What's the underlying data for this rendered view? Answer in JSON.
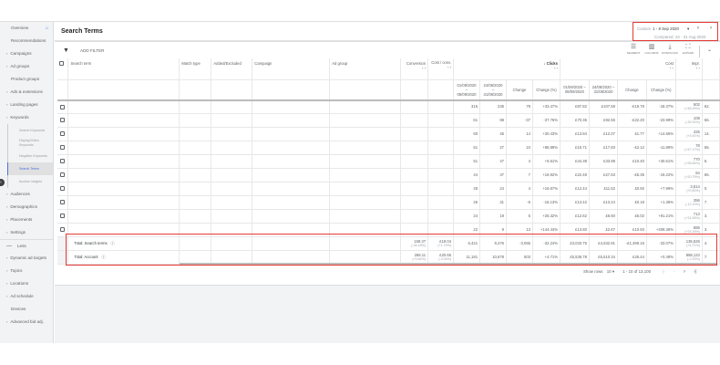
{
  "sidebar": {
    "items": [
      {
        "label": "Overview",
        "type": "top",
        "icon": "home-icon"
      },
      {
        "label": "Recommendations",
        "type": "top"
      },
      {
        "label": "Campaigns",
        "type": "exp"
      },
      {
        "label": "Ad groups",
        "type": "exp"
      },
      {
        "label": "Product groups",
        "type": "top"
      },
      {
        "label": "Ads & extensions",
        "type": "exp"
      },
      {
        "label": "Landing pages",
        "type": "exp"
      },
      {
        "label": "Keywords",
        "type": "exp"
      },
      {
        "label": "Search Keywords",
        "type": "sub"
      },
      {
        "label": "Display/Video Keywords",
        "type": "sub2"
      },
      {
        "label": "Negative Keywords",
        "type": "sub"
      },
      {
        "label": "Search Terms",
        "type": "sub",
        "active": true
      },
      {
        "label": "Auction insights",
        "type": "sub"
      },
      {
        "label": "Audiences",
        "type": "exp"
      },
      {
        "label": "Demographics",
        "type": "exp"
      },
      {
        "label": "Placements",
        "type": "exp"
      },
      {
        "label": "Settings",
        "type": "exp"
      },
      {
        "label": "Less",
        "type": "less"
      },
      {
        "label": "Dynamic ad targets",
        "type": "exp"
      },
      {
        "label": "Topics",
        "type": "exp"
      },
      {
        "label": "Locations",
        "type": "exp"
      },
      {
        "label": "Ad schedule",
        "type": "exp"
      },
      {
        "label": "Devices",
        "type": "top"
      },
      {
        "label": "Advanced bid adj.",
        "type": "exp"
      }
    ]
  },
  "header": {
    "title": "Search Terms",
    "date": {
      "label": "Custom",
      "range": "1 - 8 Sep 2020",
      "compared": "Compared: 24 - 31 Aug 2020"
    }
  },
  "toolbar": {
    "add_filter": "ADD FILTER",
    "buttons": [
      {
        "label": "SEGMENT",
        "icon": "segment-icon",
        "glyph": "☰"
      },
      {
        "label": "COLUMNS",
        "icon": "columns-icon",
        "glyph": "▥"
      },
      {
        "label": "DOWNLOAD",
        "icon": "download-icon",
        "glyph": "⤓"
      },
      {
        "label": "EXPAND",
        "icon": "expand-icon",
        "glyph": "⛶"
      }
    ]
  },
  "table": {
    "headers": {
      "search_term": "Search term",
      "match_type": "Match type",
      "added": "Added/Excluded",
      "campaign": "Campaign",
      "ad_group": "Ad group",
      "conversion": "Conversion",
      "cost_conv": "Cost / conv.",
      "clicks": "Clicks",
      "cost": "Cost",
      "impr": "Impr."
    },
    "subheaders": {
      "cur": "01/09/2020 – 08/09/2020",
      "prev": "24/08/2020 – 31/08/2020",
      "change": "Change",
      "change_pct": "Change (%)"
    },
    "rows": [
      [
        "315",
        "236",
        "79",
        "+33.47%",
        "£87.82",
        "£107.58",
        "-£19.76",
        "-18.37%",
        "502",
        "(+45.09%)",
        "62."
      ],
      [
        "61",
        "98",
        "-37",
        "-37.76%",
        "£70.35",
        "£92.55",
        "-£22.20",
        "-23.99%",
        "108",
        "(-32.92%)",
        "56."
      ],
      [
        "60",
        "46",
        "14",
        "+30.43%",
        "£13.84",
        "£12.07",
        "£1.77",
        "+14.66%",
        "425",
        "(+3.91%)",
        "14."
      ],
      [
        "51",
        "27",
        "24",
        "+88.89%",
        "£15.71",
        "£17.83",
        "-£2.12",
        "-11.89%",
        "78",
        "(+47.17%)",
        "65."
      ],
      [
        "51",
        "47",
        "4",
        "+8.51%",
        "£44.38",
        "£33.98",
        "£10.40",
        "+30.61%",
        "770",
        "(+26.64%)",
        "6."
      ],
      [
        "44",
        "37",
        "7",
        "+18.92%",
        "£22.48",
        "£27.83",
        "-£5.35",
        "-19.22%",
        "64",
        "(+20.75%)",
        "66."
      ],
      [
        "28",
        "24",
        "4",
        "+16.67%",
        "£12.44",
        "£11.52",
        "£0.92",
        "+7.99%",
        "3,614",
        "(+0.50%)",
        "0."
      ],
      [
        "26",
        "31",
        "-5",
        "-16.13%",
        "£13.42",
        "£13.24",
        "£0.18",
        "+1.36%",
        "356",
        "(-12.10%)",
        "7."
      ],
      [
        "24",
        "19",
        "5",
        "+26.32%",
        "£12.62",
        "£6.60",
        "£6.02",
        "+91.21%",
        "713",
        "(+31.55%)",
        "3."
      ],
      [
        "22",
        "9",
        "13",
        "+144.44%",
        "£13.60",
        "£2.67",
        "£10.93",
        "+409.36%",
        "686",
        "(+23.16%)",
        "3."
      ]
    ],
    "totals": [
      {
        "label": "Total: Search terms",
        "conversion": "159.37",
        "conversion_sub": "(-34.18%)",
        "cost_conv": "£19.04",
        "cost_conv_sub": "(+1.70%)",
        "vals": [
          "6,421",
          "9,476",
          "-3,055",
          "-32.24%",
          "£3,033.75",
          "£4,532.91",
          "-£1,499.16",
          "-33.07%"
        ],
        "impr": "135,526",
        "impr_sub": "(+4.71%)",
        "last": "4."
      },
      {
        "label": "Total: Account",
        "conversion": "268.11",
        "conversion_sub": "(+0.62%)",
        "cost_conv": "£20.65",
        "cost_conv_sub": "(-3.04%)",
        "vals": [
          "11,181",
          "10,678",
          "503",
          "+4.71%",
          "£5,536.78",
          "£5,510.34",
          "£26.44",
          "+0.48%"
        ],
        "impr": "888,123",
        "impr_sub": "(-2.93%)",
        "last": "7."
      }
    ]
  },
  "pagination": {
    "show_rows_label": "Show rows",
    "rows": "10",
    "range": "1 - 10 of 13,100"
  },
  "colors": {
    "highlight": "#e53935",
    "active": "#4a6ee0"
  }
}
